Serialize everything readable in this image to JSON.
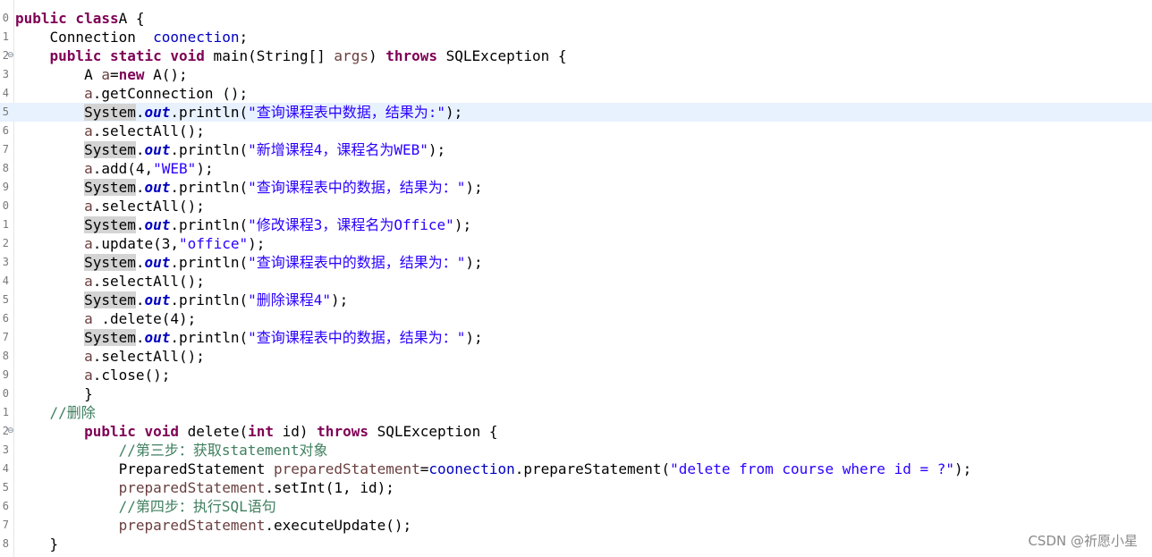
{
  "lines": [
    {
      "ln": "0",
      "fold": "",
      "segs": [
        [
          "kw",
          "public class"
        ],
        [
          "",
          "A {"
        ]
      ]
    },
    {
      "ln": "1",
      "fold": "",
      "segs": [
        [
          "",
          "    Connection  "
        ],
        [
          "fld",
          "coonection"
        ],
        [
          "",
          ";"
        ]
      ]
    },
    {
      "ln": "2",
      "fold": "⊖",
      "segs": [
        [
          "",
          "    "
        ],
        [
          "kw",
          "public static void"
        ],
        [
          "",
          " main(String[] "
        ],
        [
          "var",
          "args"
        ],
        [
          "",
          ") "
        ],
        [
          "kw",
          "throws"
        ],
        [
          "",
          " SQLException {"
        ]
      ]
    },
    {
      "ln": "3",
      "fold": "",
      "segs": [
        [
          "",
          "        A "
        ],
        [
          "var",
          "a"
        ],
        [
          "",
          "="
        ],
        [
          "kw",
          "new"
        ],
        [
          "",
          " A();"
        ]
      ]
    },
    {
      "ln": "4",
      "fold": "",
      "segs": [
        [
          "",
          "        "
        ],
        [
          "var",
          "a"
        ],
        [
          "",
          ".getConnection ();"
        ]
      ]
    },
    {
      "ln": "5",
      "fold": "",
      "current": true,
      "segs": [
        [
          "",
          "        "
        ],
        [
          "cursor",
          ""
        ],
        [
          "hl",
          "System"
        ],
        [
          "",
          "."
        ],
        [
          "sout",
          "out"
        ],
        [
          "",
          ".println("
        ],
        [
          "str",
          "\"查询课程表中数据，结果为:\""
        ],
        [
          "",
          ");"
        ]
      ]
    },
    {
      "ln": "6",
      "fold": "",
      "segs": [
        [
          "",
          "        "
        ],
        [
          "var",
          "a"
        ],
        [
          "",
          ".selectAll();"
        ]
      ]
    },
    {
      "ln": "7",
      "fold": "",
      "segs": [
        [
          "",
          "        "
        ],
        [
          "hl",
          "System"
        ],
        [
          "",
          "."
        ],
        [
          "sout",
          "out"
        ],
        [
          "",
          ".println("
        ],
        [
          "str",
          "\"新增课程4，课程名为WEB\""
        ],
        [
          "",
          ");"
        ]
      ]
    },
    {
      "ln": "8",
      "fold": "",
      "segs": [
        [
          "",
          "        "
        ],
        [
          "var",
          "a"
        ],
        [
          "",
          ".add(4,"
        ],
        [
          "str",
          "\"WEB\""
        ],
        [
          "",
          ");"
        ]
      ]
    },
    {
      "ln": "9",
      "fold": "",
      "segs": [
        [
          "",
          "        "
        ],
        [
          "hl",
          "System"
        ],
        [
          "",
          "."
        ],
        [
          "sout",
          "out"
        ],
        [
          "",
          ".println("
        ],
        [
          "str",
          "\"查询课程表中的数据，结果为：\""
        ],
        [
          "",
          ");"
        ]
      ]
    },
    {
      "ln": "0",
      "fold": "",
      "segs": [
        [
          "",
          "        "
        ],
        [
          "var",
          "a"
        ],
        [
          "",
          ".selectAll();"
        ]
      ]
    },
    {
      "ln": "1",
      "fold": "",
      "segs": [
        [
          "",
          "        "
        ],
        [
          "hl",
          "System"
        ],
        [
          "",
          "."
        ],
        [
          "sout",
          "out"
        ],
        [
          "",
          ".println("
        ],
        [
          "str",
          "\"修改课程3，课程名为Office\""
        ],
        [
          "",
          ");"
        ]
      ]
    },
    {
      "ln": "2",
      "fold": "",
      "segs": [
        [
          "",
          "        "
        ],
        [
          "var",
          "a"
        ],
        [
          "",
          ".update(3,"
        ],
        [
          "str",
          "\"office\""
        ],
        [
          "",
          ");"
        ]
      ]
    },
    {
      "ln": "3",
      "fold": "",
      "segs": [
        [
          "",
          "        "
        ],
        [
          "hl",
          "System"
        ],
        [
          "",
          "."
        ],
        [
          "sout",
          "out"
        ],
        [
          "",
          ".println("
        ],
        [
          "str",
          "\"查询课程表中的数据，结果为：\""
        ],
        [
          "",
          ");"
        ]
      ]
    },
    {
      "ln": "4",
      "fold": "",
      "segs": [
        [
          "",
          "        "
        ],
        [
          "var",
          "a"
        ],
        [
          "",
          ".selectAll();"
        ]
      ]
    },
    {
      "ln": "5",
      "fold": "",
      "segs": [
        [
          "",
          "        "
        ],
        [
          "hl",
          "System"
        ],
        [
          "",
          "."
        ],
        [
          "sout",
          "out"
        ],
        [
          "",
          ".println("
        ],
        [
          "str",
          "\"删除课程4\""
        ],
        [
          "",
          ");"
        ]
      ]
    },
    {
      "ln": "6",
      "fold": "",
      "segs": [
        [
          "",
          "        "
        ],
        [
          "var",
          "a"
        ],
        [
          "",
          " .delete(4);"
        ]
      ]
    },
    {
      "ln": "7",
      "fold": "",
      "segs": [
        [
          "",
          "        "
        ],
        [
          "hl",
          "System"
        ],
        [
          "",
          "."
        ],
        [
          "sout",
          "out"
        ],
        [
          "",
          ".println("
        ],
        [
          "str",
          "\"查询课程表中的数据，结果为：\""
        ],
        [
          "",
          ");"
        ]
      ]
    },
    {
      "ln": "8",
      "fold": "",
      "segs": [
        [
          "",
          "        "
        ],
        [
          "var",
          "a"
        ],
        [
          "",
          ".selectAll();"
        ]
      ]
    },
    {
      "ln": "9",
      "fold": "",
      "segs": [
        [
          "",
          "        "
        ],
        [
          "var",
          "a"
        ],
        [
          "",
          ".close();"
        ]
      ]
    },
    {
      "ln": "0",
      "fold": "",
      "segs": [
        [
          "",
          "        }"
        ]
      ]
    },
    {
      "ln": "1",
      "fold": "",
      "segs": [
        [
          "",
          "    "
        ],
        [
          "cmt",
          "//删除"
        ]
      ]
    },
    {
      "ln": "2",
      "fold": "⊖",
      "segs": [
        [
          "",
          "        "
        ],
        [
          "kw",
          "public void"
        ],
        [
          "",
          " delete("
        ],
        [
          "kw",
          "int"
        ],
        [
          "",
          " id) "
        ],
        [
          "kw",
          "throws"
        ],
        [
          "",
          " SQLException {"
        ]
      ]
    },
    {
      "ln": "3",
      "fold": "",
      "segs": [
        [
          "",
          "            "
        ],
        [
          "cmt",
          "//第三步：获取statement对象"
        ]
      ]
    },
    {
      "ln": "4",
      "fold": "",
      "segs": [
        [
          "",
          "            PreparedStatement "
        ],
        [
          "var",
          "preparedStatement"
        ],
        [
          "",
          "="
        ],
        [
          "fld",
          "coonection"
        ],
        [
          "",
          ".prepareStatement("
        ],
        [
          "str",
          "\"delete from course where id = ?\""
        ],
        [
          "",
          ");"
        ]
      ]
    },
    {
      "ln": "5",
      "fold": "",
      "segs": [
        [
          "",
          "            "
        ],
        [
          "var",
          "preparedStatement"
        ],
        [
          "",
          ".setInt(1, id);"
        ]
      ]
    },
    {
      "ln": "6",
      "fold": "",
      "segs": [
        [
          "",
          "            "
        ],
        [
          "cmt",
          "//第四步：执行SQL语句"
        ]
      ]
    },
    {
      "ln": "7",
      "fold": "",
      "segs": [
        [
          "",
          "            "
        ],
        [
          "var",
          "preparedStatement"
        ],
        [
          "",
          ".executeUpdate();"
        ]
      ]
    },
    {
      "ln": "8",
      "fold": "",
      "segs": [
        [
          "",
          "    }"
        ]
      ]
    }
  ],
  "watermark": "CSDN @祈愿小星"
}
